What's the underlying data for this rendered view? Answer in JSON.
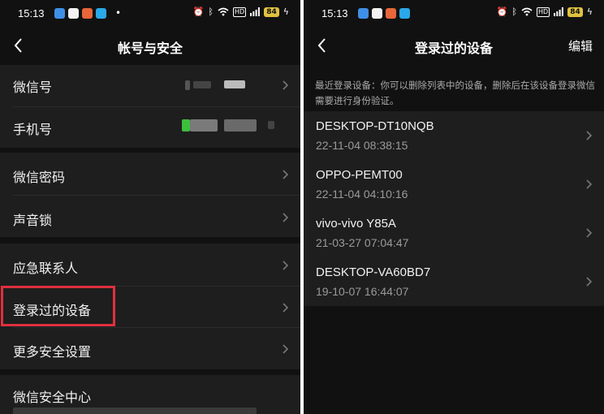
{
  "left_screen": {
    "status_bar": {
      "time": "15:13",
      "hd": "HD",
      "battery": "84"
    },
    "title": "帐号与安全",
    "rows": [
      {
        "label": "微信号"
      },
      {
        "label": "手机号"
      },
      {
        "label": "微信密码"
      },
      {
        "label": "声音锁"
      },
      {
        "label": "应急联系人"
      },
      {
        "label": "登录过的设备"
      },
      {
        "label": "更多安全设置"
      },
      {
        "label": "微信安全中心"
      }
    ],
    "highlight_color": "#e0303f"
  },
  "right_screen": {
    "status_bar": {
      "time": "15:13",
      "hd": "HD",
      "battery": "84"
    },
    "title": "登录过的设备",
    "edit_label": "编辑",
    "notice": "最近登录设备：你可以删除列表中的设备，删除后在该设备登录微信需要进行身份验证。",
    "devices": [
      {
        "name": "DESKTOP-DT10NQB",
        "time": "22-11-04 08:38:15"
      },
      {
        "name": "OPPO-PEMT00",
        "time": "22-11-04 04:10:16"
      },
      {
        "name": "vivo-vivo Y85A",
        "time": "21-03-27 07:04:47"
      },
      {
        "name": "DESKTOP-VA60BD7",
        "time": "19-10-07 16:44:07"
      }
    ]
  },
  "icons": [
    "back-arrow-icon",
    "chevron-right-icon",
    "alarm-icon",
    "bluetooth-icon",
    "wifi-icon",
    "signal-icon",
    "charging-icon"
  ],
  "colors": {
    "background": "#111111",
    "row": "#1e1e1e",
    "text": "#f0f0f0",
    "secondary_text": "#9a9a9a"
  }
}
